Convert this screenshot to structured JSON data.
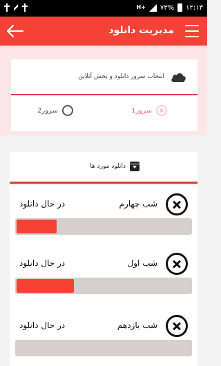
{
  "status_bar": {
    "battery": "۷۳%",
    "time": "۱۲:۱۳",
    "network": "H+"
  },
  "app_bar": {
    "title": "مدیریت دانلود",
    "menu_icon": "hamburger-menu-icon",
    "back_icon": "arrow-left-icon"
  },
  "server_section": {
    "title": "انتخاب سرور دانلود و پخش آنلاین",
    "icon": "cloud-icon",
    "options": [
      {
        "label": "سرور1",
        "checked": true
      },
      {
        "label": "سرور2",
        "checked": false
      }
    ]
  },
  "downloads_section": {
    "title": "دانلود مورد ها",
    "icon": "download-box-icon",
    "items": [
      {
        "name": "شب چهارم",
        "status": "در حال دانلود",
        "progress": 0.23
      },
      {
        "name": "شب اول",
        "status": "در حال دانلود",
        "progress": 0.33
      },
      {
        "name": "شب یازدهم",
        "status": "در حال دانلود",
        "progress": 0.0
      }
    ]
  },
  "colors": {
    "accent": "#f44336",
    "divider": "#e53935",
    "track": "#d6cfcf",
    "pink_band": "#fde6e6"
  }
}
